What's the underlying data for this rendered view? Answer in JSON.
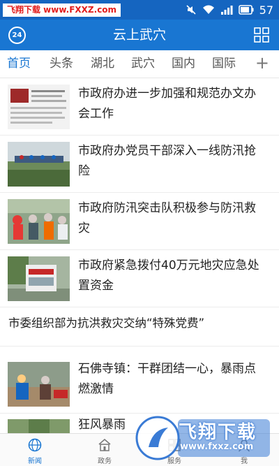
{
  "status_bar": {
    "watermark": "飞翔下载 www.FXXZ.com",
    "time": "57",
    "icons": [
      "mute-icon",
      "wifi-icon",
      "signal-icon",
      "battery-icon"
    ]
  },
  "app_bar": {
    "title": "云上武穴",
    "weather_badge": "24",
    "menu_icon": "grid-icon"
  },
  "tabs": [
    {
      "label": "首页",
      "active": true
    },
    {
      "label": "头条",
      "active": false
    },
    {
      "label": "湖北",
      "active": false
    },
    {
      "label": "武穴",
      "active": false
    },
    {
      "label": "国内",
      "active": false
    },
    {
      "label": "国际",
      "active": false
    }
  ],
  "tabs_more": "+",
  "news": [
    {
      "title": "市政府办进一步加强和规范办文办会工作",
      "has_image": true
    },
    {
      "title": "市政府办党员干部深入一线防汛抢险",
      "has_image": true
    },
    {
      "title": "市政府防汛突击队积极参与防汛救灾",
      "has_image": true
    },
    {
      "title": "市政府紧急拨付40万元地灾应急处置资金",
      "has_image": true
    },
    {
      "title": "市委组织部为抗洪救灾交纳“特殊党费”",
      "has_image": false
    },
    {
      "title": "石佛寺镇：干群团结一心，暴雨点燃激情",
      "has_image": true
    },
    {
      "title": "狂风暴雨",
      "has_image": true
    }
  ],
  "bottom_nav": [
    {
      "label": "新闻",
      "icon": "globe-icon",
      "active": true
    },
    {
      "label": "政务",
      "icon": "building-icon",
      "active": false
    },
    {
      "label": "服务",
      "icon": "service-icon",
      "active": false
    },
    {
      "label": "我",
      "icon": "person-icon",
      "active": false
    }
  ],
  "watermark_bottom": {
    "text": "飞翔下载",
    "url": "www.fxxz.com"
  },
  "colors": {
    "primary": "#1976d2",
    "status_bar": "#1565c0",
    "watermark_red": "#e31b1b"
  }
}
